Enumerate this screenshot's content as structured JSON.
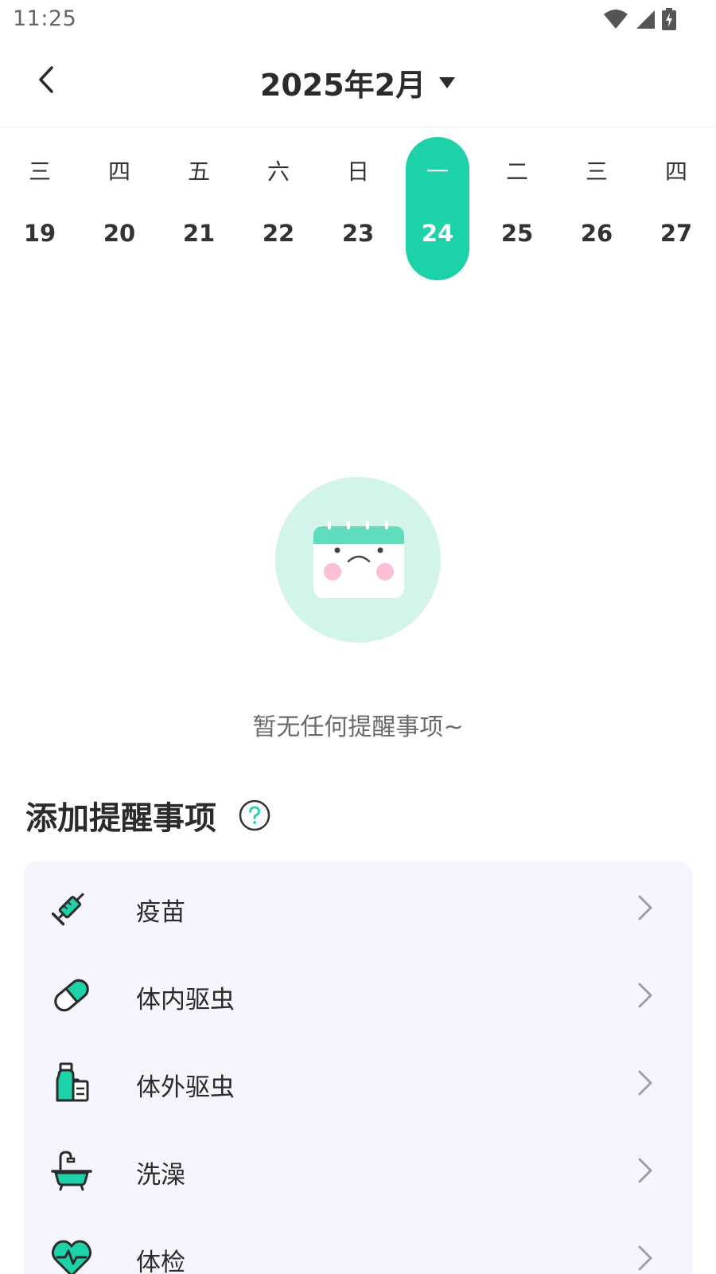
{
  "status_bar": {
    "time": "11:25",
    "icons": [
      "wifi-icon",
      "signal-icon",
      "battery-charging-icon"
    ]
  },
  "header": {
    "back_icon": "chevron-left-icon",
    "month_label": "2025年2月",
    "dropdown_icon": "caret-down-icon"
  },
  "date_strip": {
    "days": [
      {
        "weekday": "三",
        "date": "19"
      },
      {
        "weekday": "四",
        "date": "20"
      },
      {
        "weekday": "五",
        "date": "21"
      },
      {
        "weekday": "六",
        "date": "22"
      },
      {
        "weekday": "日",
        "date": "23"
      },
      {
        "weekday": "一",
        "date": "24"
      },
      {
        "weekday": "二",
        "date": "25"
      },
      {
        "weekday": "三",
        "date": "26"
      },
      {
        "weekday": "四",
        "date": "27"
      }
    ],
    "selected_date": "24",
    "accent_color": "#1dd2a8"
  },
  "empty_state": {
    "icon": "sad-calendar-icon",
    "message": "暂无任何提醒事项~"
  },
  "add_section": {
    "title": "添加提醒事项",
    "help_icon": "question-circle-icon",
    "items": [
      {
        "label": "疫苗",
        "icon": "syringe-icon"
      },
      {
        "label": "体内驱虫",
        "icon": "pill-capsule-icon"
      },
      {
        "label": "体外驱虫",
        "icon": "spray-bottle-icon"
      },
      {
        "label": "洗澡",
        "icon": "bathtub-icon"
      },
      {
        "label": "体检",
        "icon": "heart-pulse-icon"
      }
    ]
  }
}
